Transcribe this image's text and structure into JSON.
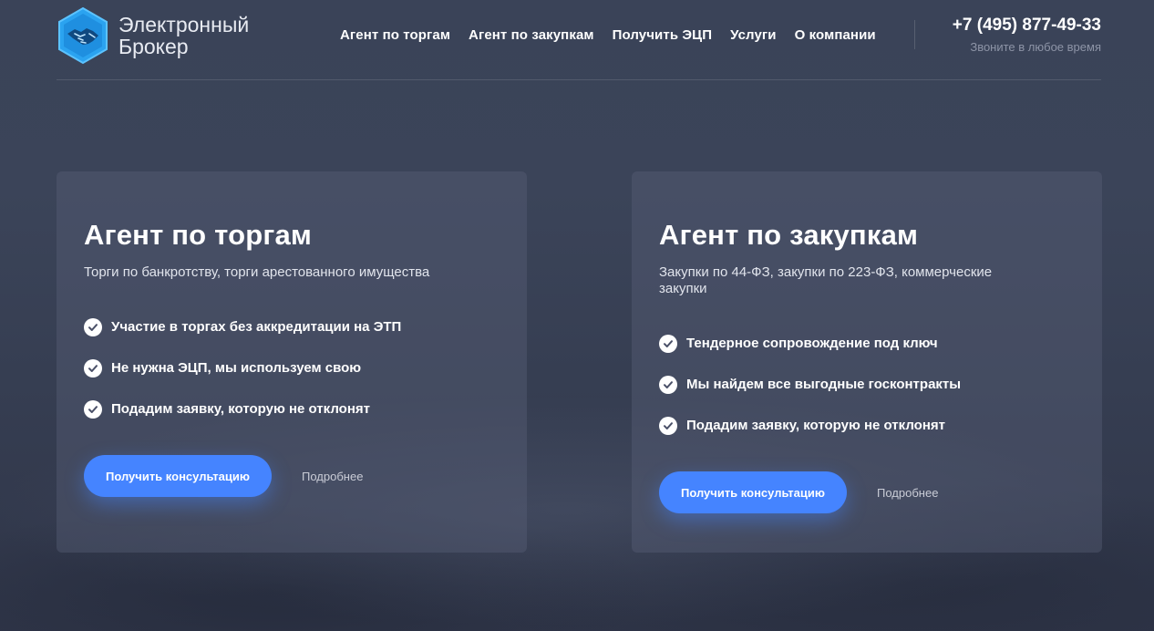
{
  "brand": {
    "line1": "Электронный",
    "line2": "Брокер"
  },
  "nav": [
    {
      "label": "Агент по торгам"
    },
    {
      "label": "Агент по закупкам"
    },
    {
      "label": "Получить ЭЦП"
    },
    {
      "label": "Услуги"
    },
    {
      "label": "О компании"
    }
  ],
  "contact": {
    "phone": "+7 (495) 877-49-33",
    "note": "Звоните в любое время"
  },
  "cards": [
    {
      "title": "Агент по торгам",
      "subtitle": "Торги по банкротству, торги арестованного имущества",
      "features": [
        "Участие в торгах без аккредитации на ЭТП",
        "Не нужна ЭЦП, мы используем свою",
        "Подадим заявку, которую не отклонят"
      ],
      "button": "Получить консультацию",
      "more": "Подробнее"
    },
    {
      "title": "Агент по закупкам",
      "subtitle": "Закупки по 44-ФЗ, закупки по 223-ФЗ, коммерческие закупки",
      "features": [
        "Тендерное сопровождение под ключ",
        "Мы найдем все выгодные госконтракты",
        "Подадим заявку, которую не отклонят"
      ],
      "button": "Получить консультацию",
      "more": "Подробнее"
    }
  ],
  "colors": {
    "accent": "#4584ff",
    "logo_blue": "#2ba3f0"
  },
  "icons": {
    "logo": "handshake-hexagon-icon",
    "feature": "check-circle-icon"
  }
}
